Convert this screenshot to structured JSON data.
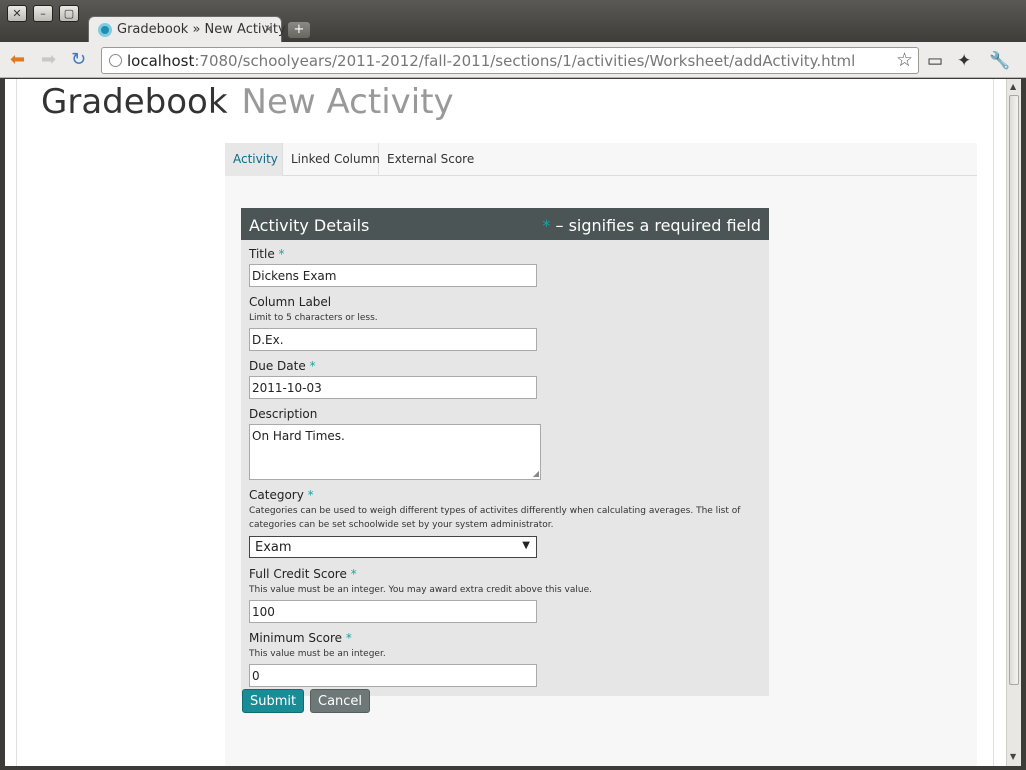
{
  "window": {
    "close_glyph": "✕",
    "minimize_glyph": "–",
    "maximize_glyph": "▢"
  },
  "browser": {
    "tab_title": "Gradebook » New Activity",
    "tab_close": "×",
    "new_tab": "+",
    "url_host": "localhost",
    "url_rest": ":7080/schoolyears/2011-2012/fall-2011/sections/1/activities/Worksheet/addActivity.html"
  },
  "page": {
    "title": "Gradebook",
    "subtitle": "New Activity",
    "tabs": [
      {
        "label": "Activity"
      },
      {
        "label": "Linked Column"
      },
      {
        "label": "External Score"
      }
    ]
  },
  "form": {
    "legend_title": "Activity Details",
    "required_marker": "*",
    "required_note": " – signifies a required field",
    "title_label": "Title",
    "title_value": "Dickens Exam",
    "column_label_label": "Column Label",
    "column_label_hint": "Limit to 5 characters or less.",
    "column_label_value": "D.Ex.",
    "due_date_label": "Due Date",
    "due_date_value": "2011-10-03",
    "description_label": "Description",
    "description_value": "On Hard Times.",
    "category_label": "Category",
    "category_hint": "Categories can be used to weigh different types of activites differently when calculating averages. The list of categories can be set schoolwide set by your system administrator.",
    "category_value": "Exam",
    "full_credit_label": "Full Credit Score",
    "full_credit_hint": "This value must be an integer. You may award extra credit above this value.",
    "full_credit_value": "100",
    "minimum_label": "Minimum Score",
    "minimum_hint": "This value must be an integer.",
    "minimum_value": "0",
    "submit_label": "Submit",
    "cancel_label": "Cancel"
  },
  "colors": {
    "accent": "#1a8c95",
    "legend_bg": "#4b5555",
    "required": "#1aa3a3"
  }
}
